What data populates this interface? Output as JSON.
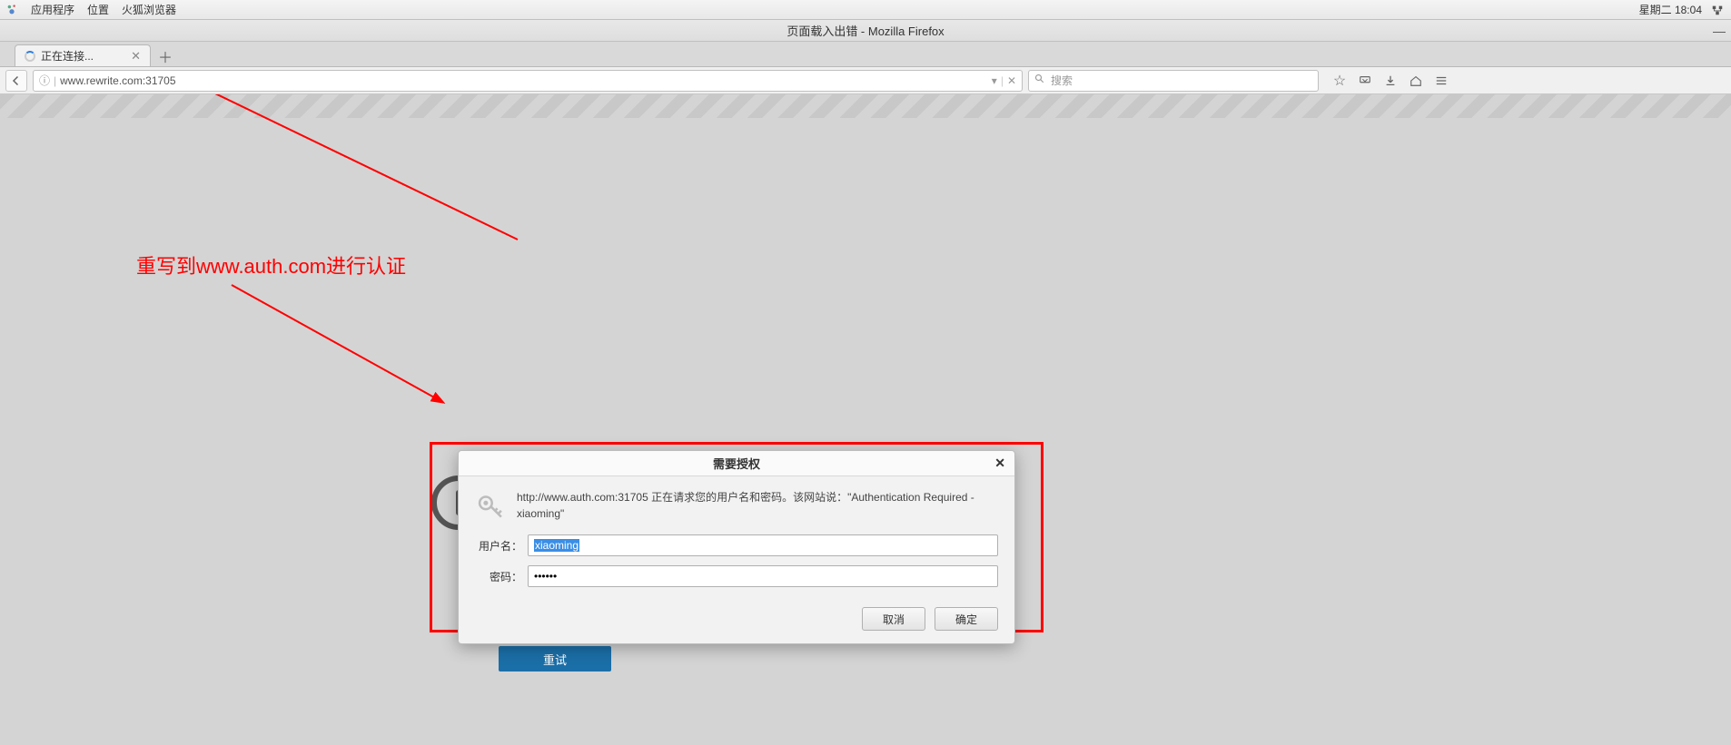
{
  "sysbar": {
    "apps": "应用程序",
    "places": "位置",
    "firefox": "火狐浏览器",
    "clock": "星期二 18:04"
  },
  "window": {
    "title": "页面载入出错  -  Mozilla Firefox"
  },
  "tab": {
    "label": "正在连接..."
  },
  "addressbar": {
    "url": "www.rewrite.com:31705"
  },
  "searchbar": {
    "placeholder": "搜索"
  },
  "annotation": "重写到www.auth.com进行认证",
  "retry_label": "重试",
  "dialog": {
    "title": "需要授权",
    "message": "http://www.auth.com:31705 正在请求您的用户名和密码。该网站说：\"Authentication Required - xiaoming\"",
    "username_label": "用户名：",
    "password_label": "密码：",
    "username_value": "xiaoming",
    "password_value": "••••••",
    "cancel": "取消",
    "ok": "确定"
  }
}
